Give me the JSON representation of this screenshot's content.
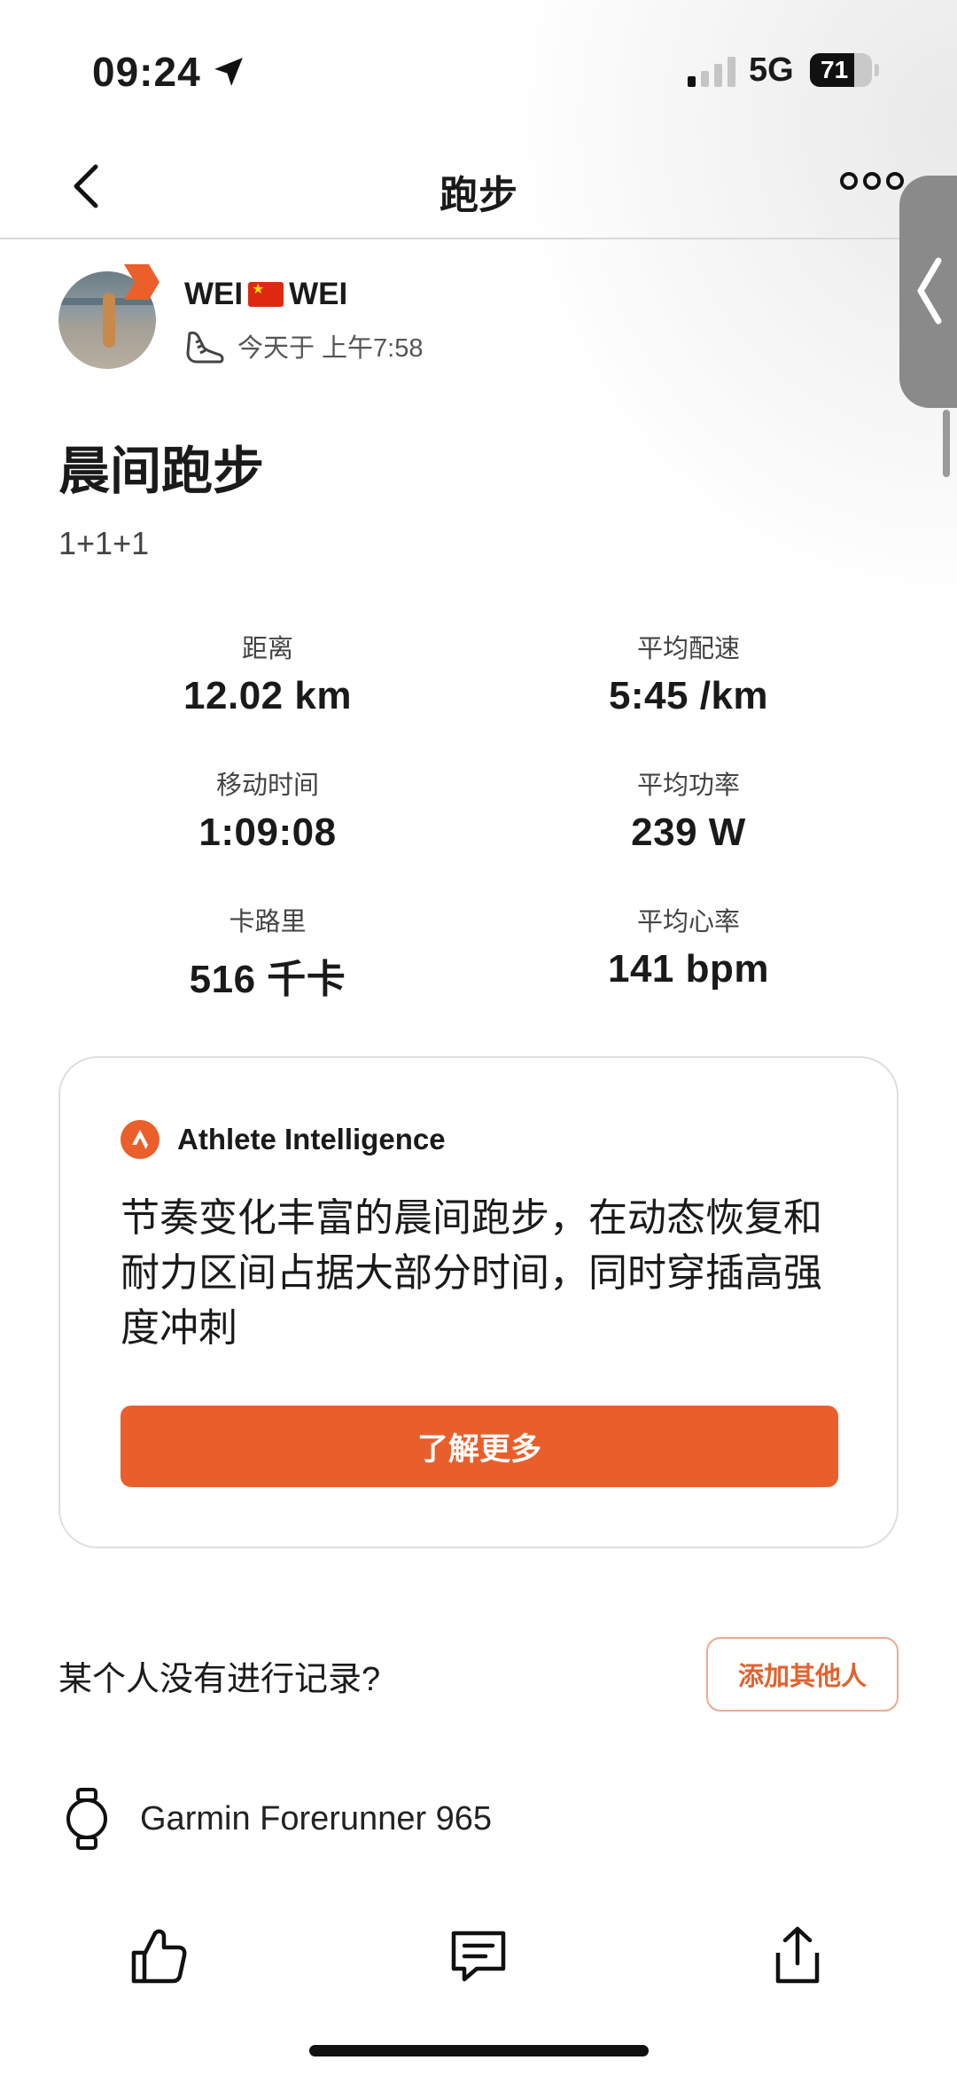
{
  "status_bar": {
    "time": "09:24",
    "network": "5G",
    "battery": "71",
    "battery_level": 0.71
  },
  "nav": {
    "title": "跑步"
  },
  "athlete": {
    "name_part1": "WEI",
    "name_part2": "WEI",
    "timestamp": "今天于 上午7:58"
  },
  "activity": {
    "title": "晨间跑步",
    "description": "1+1+1"
  },
  "stats": [
    {
      "label": "距离",
      "value": "12.02 km"
    },
    {
      "label": "平均配速",
      "value": "5:45 /km"
    },
    {
      "label": "移动时间",
      "value": "1:09:08"
    },
    {
      "label": "平均功率",
      "value": "239 W"
    },
    {
      "label": "卡路里",
      "value": "516 千卡"
    },
    {
      "label": "平均心率",
      "value": "141 bpm"
    }
  ],
  "ai_card": {
    "heading": "Athlete Intelligence",
    "summary": "节奏变化丰富的晨间跑步，在动态恢复和耐力区间占据大部分时间，同时穿插高强度冲刺",
    "button": "了解更多"
  },
  "add_others": {
    "question": "某个人没有进行记录?",
    "button": "添加其他人"
  },
  "device": {
    "name": "Garmin Forerunner 965"
  },
  "colors": {
    "accent": "#e95f2b",
    "text": "#1a1a1a",
    "muted": "#444444"
  },
  "icons": [
    "location-arrow-icon",
    "chevron-left-icon",
    "more-icon",
    "chevron-left-icon",
    "shoe-icon",
    "strava-icon",
    "watch-icon",
    "like-icon",
    "comment-icon",
    "share-icon"
  ]
}
